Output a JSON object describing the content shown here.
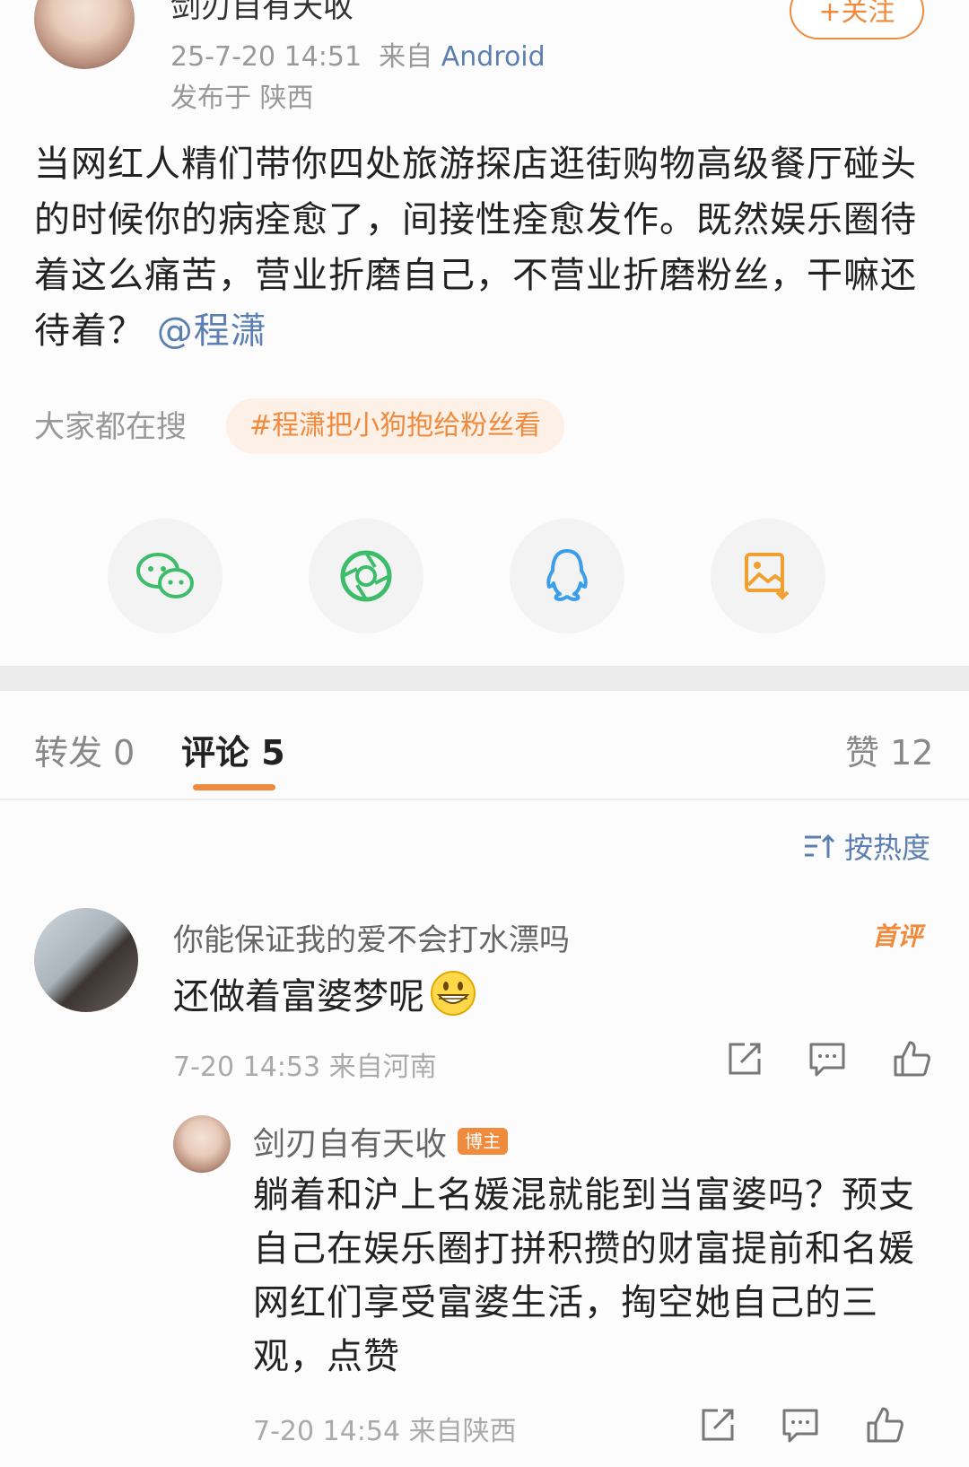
{
  "post": {
    "author_name": "剑刃自有天收",
    "timestamp": "25-7-20 14:51",
    "source_prefix": "来自",
    "source": "Android",
    "location": "发布于 陕西",
    "follow_label": "+关注",
    "body_text": "当网红人精们带你四处旅游探店逛街购物高级餐厅碰头的时候你的病痊愈了，间接性痊愈发作。既然娱乐圈待着这么痛苦，营业折磨自己，不营业折磨粉丝，干嘛还待着？",
    "mention": "@程潇"
  },
  "search": {
    "label": "大家都在搜",
    "hashtag": "#程潇把小狗抱给粉丝看"
  },
  "share": {
    "icons": [
      "wechat-icon",
      "moments-icon",
      "qq-icon",
      "save-image-icon"
    ],
    "colors": {
      "wechat": "#3dbd6a",
      "moments": "#3dbd6a",
      "qq": "#3a9ee8",
      "save": "#f0a030"
    }
  },
  "tabs": {
    "repost": "转发 0",
    "comments": "评论 5",
    "likes": "赞 12"
  },
  "sort_label": "按热度",
  "comments": [
    {
      "name": "你能保证我的爱不会打水漂吗",
      "badge": "首评",
      "text": "还做着富婆梦呢",
      "time": "7-20 14:53 来自河南",
      "reply": {
        "name": "剑刃自有天收",
        "badge": "博主",
        "text": "躺着和沪上名媛混就能到当富婆吗？预支自己在娱乐圈打拼积攒的财富提前和名媛网红们享受富婆生活，掏空她自己的三观，点赞",
        "time": "7-20 14:54 来自陕西"
      }
    }
  ],
  "accent_color": "#f08a3c",
  "link_color": "#5a7fb0"
}
